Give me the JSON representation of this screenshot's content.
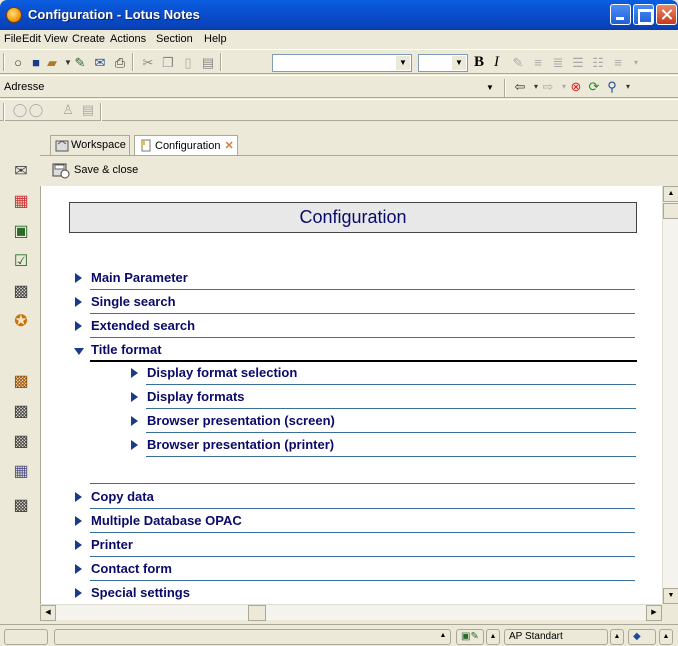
{
  "window": {
    "title": "Configuration - Lotus Notes"
  },
  "menu": [
    "File",
    "Edit",
    "View",
    "Create",
    "Actions",
    "Section",
    "Help"
  ],
  "address": {
    "label": "Adresse",
    "value": ""
  },
  "format_bar": {
    "bold": "B",
    "italic": "I"
  },
  "tabs": [
    {
      "label": "Workspace",
      "icon": "workspace-icon"
    },
    {
      "label": "Configuration",
      "icon": "document-icon",
      "close": "✕"
    }
  ],
  "actions": {
    "save_close": "Save & close"
  },
  "document": {
    "title": "Configuration",
    "sections": [
      {
        "label": "Main Parameter",
        "expanded": false
      },
      {
        "label": "Single search",
        "expanded": false
      },
      {
        "label": "Extended search",
        "expanded": false
      },
      {
        "label": "Title format",
        "expanded": true,
        "children": [
          "Display format selection",
          "Display formats",
          "Browser presentation (screen)",
          "Browser presentation (printer)"
        ]
      },
      {
        "label": "Copy data",
        "expanded": false
      },
      {
        "label": "Multiple Database OPAC",
        "expanded": false
      },
      {
        "label": "Printer",
        "expanded": false
      },
      {
        "label": "Contact form",
        "expanded": false
      },
      {
        "label": "Special settings",
        "expanded": false
      }
    ]
  },
  "status": {
    "location": "AP Standart"
  }
}
